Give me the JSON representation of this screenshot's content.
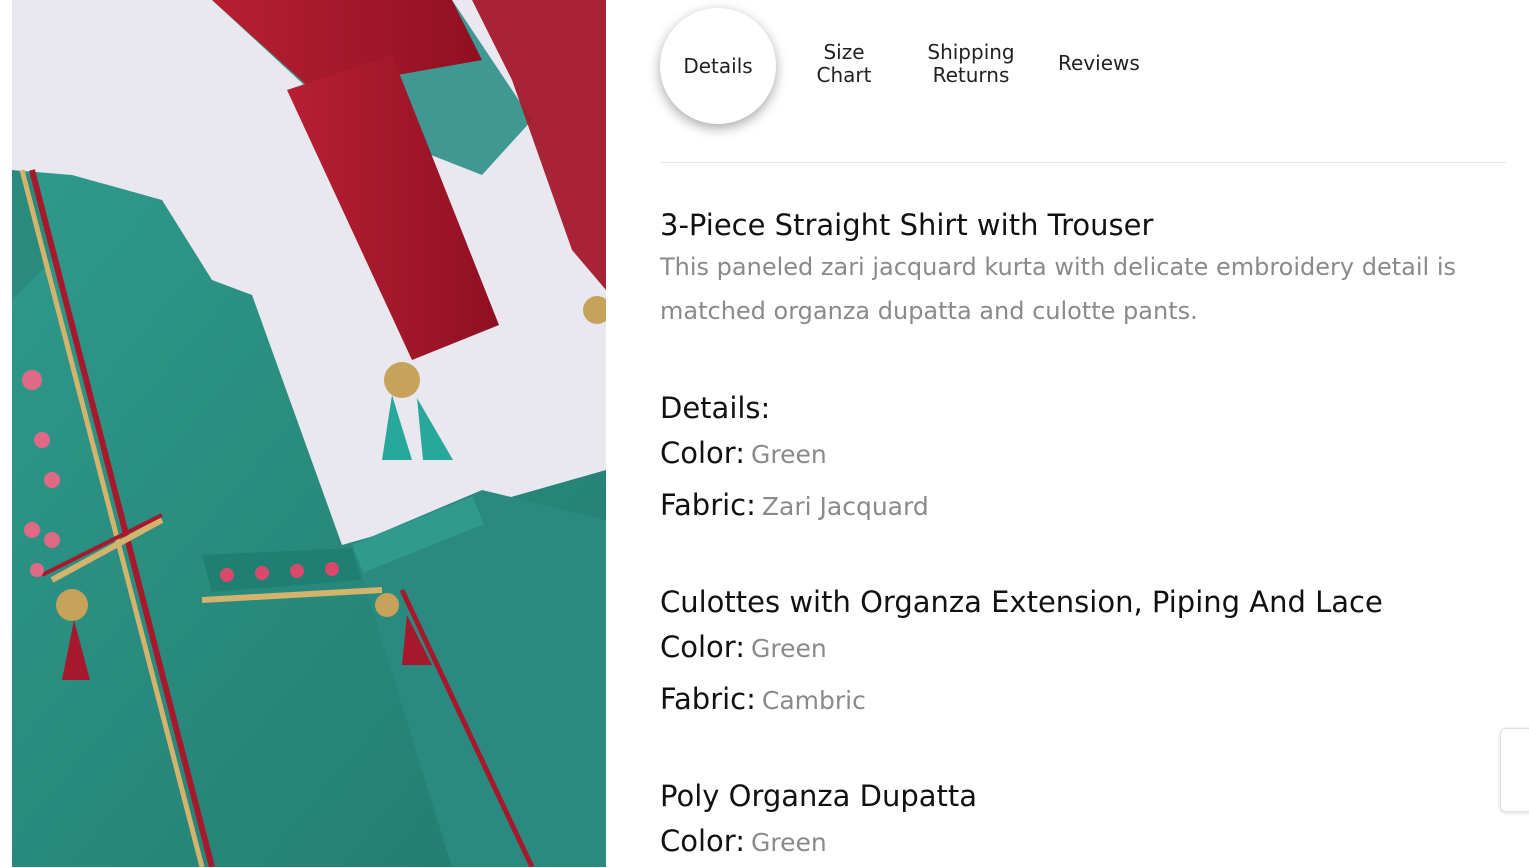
{
  "tabs": [
    {
      "label": "Details",
      "lines": [
        "Details"
      ],
      "active": true
    },
    {
      "label": "Size Chart",
      "lines": [
        "Size",
        "Chart"
      ],
      "active": false
    },
    {
      "label": "Shipping Returns",
      "lines": [
        "Shipping",
        "Returns"
      ],
      "active": false
    },
    {
      "label": "Reviews",
      "lines": [
        "Reviews"
      ],
      "active": false
    }
  ],
  "product": {
    "title": "3-Piece Straight Shirt with Trouser",
    "description": "This paneled zari jacquard kurta with delicate embroidery detail is matched organza dupatta and culotte pants."
  },
  "sections": [
    {
      "heading": "Details:",
      "rows": [
        {
          "label": "Color:",
          "value": "Green"
        },
        {
          "label": "Fabric:",
          "value": "Zari Jacquard"
        }
      ]
    },
    {
      "heading": "Culottes with Organza Extension, Piping And Lace",
      "rows": [
        {
          "label": "Color:",
          "value": "Green"
        },
        {
          "label": "Fabric:",
          "value": "Cambric"
        }
      ]
    },
    {
      "heading": "Poly Organza Dupatta",
      "rows": [
        {
          "label": "Color:",
          "value": "Green"
        }
      ]
    }
  ],
  "colors": {
    "teal_fabric": "#2f9184",
    "red_dupatta": "#a8182c",
    "muted_text": "#8a8a8a"
  }
}
